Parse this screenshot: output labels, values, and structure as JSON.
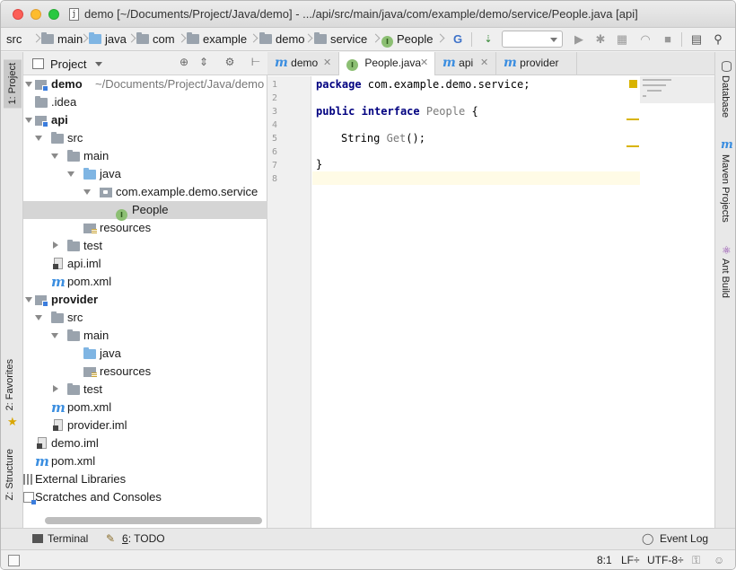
{
  "window": {
    "title": "demo [~/Documents/Project/Java/demo] - .../api/src/main/java/com/example/demo/service/People.java [api]",
    "file_icon_letter": "j"
  },
  "navbar": {
    "crumbs": [
      "src",
      "main",
      "java",
      "com",
      "example",
      "demo",
      "service",
      "People"
    ],
    "run_config_value": ""
  },
  "left_strip": {
    "tabs": [
      "1: Project",
      "2: Favorites",
      "Z: Structure"
    ]
  },
  "project_panel": {
    "title": "Project",
    "tree": [
      {
        "label": "demo",
        "suffix": "~/Documents/Project/Java/demo",
        "kind": "module",
        "expanded": true,
        "bold": true
      },
      {
        "label": ".idea",
        "kind": "folder",
        "expanded": false
      },
      {
        "label": "api",
        "kind": "module",
        "expanded": true,
        "bold": true
      },
      {
        "label": "src",
        "kind": "folder",
        "expanded": true
      },
      {
        "label": "main",
        "kind": "folder",
        "expanded": true
      },
      {
        "label": "java",
        "kind": "source-folder",
        "expanded": true
      },
      {
        "label": "com.example.demo.service",
        "kind": "package",
        "expanded": true
      },
      {
        "label": "People",
        "kind": "interface",
        "selected": true
      },
      {
        "label": "resources",
        "kind": "resources-folder"
      },
      {
        "label": "test",
        "kind": "folder",
        "expanded": false
      },
      {
        "label": "api.iml",
        "kind": "iml-file"
      },
      {
        "label": "pom.xml",
        "kind": "maven-file"
      },
      {
        "label": "provider",
        "kind": "module",
        "expanded": true,
        "bold": true
      },
      {
        "label": "src",
        "kind": "folder",
        "expanded": true
      },
      {
        "label": "main",
        "kind": "folder",
        "expanded": true
      },
      {
        "label": "java",
        "kind": "source-folder"
      },
      {
        "label": "resources",
        "kind": "resources-folder"
      },
      {
        "label": "test",
        "kind": "folder",
        "expanded": false
      },
      {
        "label": "pom.xml",
        "kind": "maven-file"
      },
      {
        "label": "provider.iml",
        "kind": "iml-file"
      },
      {
        "label": "demo.iml",
        "kind": "iml-file"
      },
      {
        "label": "pom.xml",
        "kind": "maven-file"
      },
      {
        "label": "External Libraries",
        "kind": "libraries"
      },
      {
        "label": "Scratches and Consoles",
        "kind": "scratches"
      }
    ]
  },
  "editor": {
    "tabs": [
      {
        "label": "demo",
        "icon": "maven-icon"
      },
      {
        "label": "People.java",
        "icon": "interface-icon",
        "active": true
      },
      {
        "label": "api",
        "icon": "maven-icon"
      },
      {
        "label": "provider",
        "icon": "maven-icon"
      }
    ],
    "line_numbers": [
      "1",
      "2",
      "3",
      "4",
      "5",
      "6",
      "7",
      "8"
    ],
    "code": {
      "l1_kw": "package",
      "l1_rest": " com.example.demo.service;",
      "l3_kw1": "public",
      "l3_kw2": "interface",
      "l3_name": "People",
      "l3_rest": " {",
      "l5_type": "String",
      "l5_fn": "Get",
      "l5_rest": "();",
      "l7": "}"
    },
    "current_line": 8
  },
  "right_strip": {
    "tabs": [
      "Database",
      "Maven Projects",
      "Ant Build"
    ]
  },
  "bottom_tools": {
    "terminal": "Terminal",
    "todo_num": "6",
    "todo_label": ": TODO",
    "event_log": "Event Log"
  },
  "status_bar": {
    "position": "8:1",
    "line_sep": "LF÷",
    "encoding": "UTF-8÷"
  }
}
